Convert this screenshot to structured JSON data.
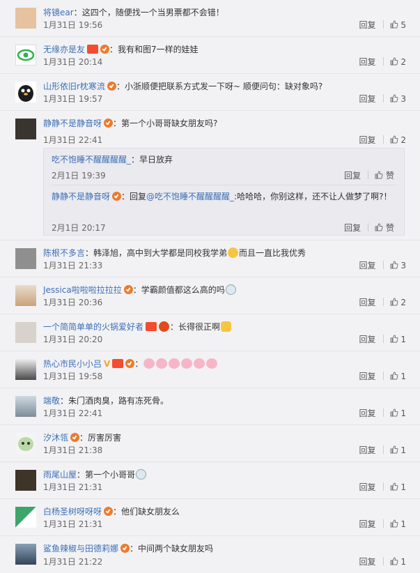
{
  "labels": {
    "reply": "回复",
    "like": "赞"
  },
  "comments": [
    {
      "user": "将镜ear",
      "text": "这四个，随便找一个当男票都不会错！",
      "time": "1月31日 19:56",
      "likes": "5",
      "avatar": "#e6c2a0"
    },
    {
      "user": "无缘亦是友",
      "text": "我有和图7一样的娃娃",
      "time": "1月31日 20:14",
      "likes": "2",
      "avatar": "#2db34a"
    },
    {
      "user": "山形依旧r枕寒流",
      "text": "小浙顺便把联系方式发一下呀~ 顺便问句：缺对象吗?",
      "time": "1月31日 19:57",
      "likes": "3",
      "avatar": "#222222"
    },
    {
      "user": "静静不是静音呀",
      "text": "第一个小哥哥缺女朋友吗?",
      "time": "1月31日 22:41",
      "likes": "2",
      "avatar": "#3a3430"
    },
    {
      "user": "陈根不多言",
      "text_a": "韩泽旭，高中到大学都是同校我学弟",
      "text_b": "而且一直比我优秀",
      "time": "1月31日 21:33",
      "likes": "3",
      "avatar": "#8f8f8f"
    },
    {
      "user": "Jessica啦啦啦拉拉拉",
      "text": "学霸颜值都这么高的吗",
      "time": "1月31日 20:36",
      "likes": "2",
      "avatar": "#c9a27c"
    },
    {
      "user": "一个简简单单的火锅爱好者",
      "text": "长得很正啊",
      "time": "1月31日 20:20",
      "likes": "1",
      "avatar": "#d8d2cc"
    },
    {
      "user": "热心市民小小吕",
      "time": "1月31日 19:58",
      "likes": "1",
      "avatar": "#4a4a4a"
    },
    {
      "user": "端敬",
      "text": "朱门酒肉臭，路有冻死骨。",
      "time": "1月31日 22:41",
      "likes": "1",
      "avatar": "#7d8c99"
    },
    {
      "user": "汐沐瓴",
      "text": "厉害厉害",
      "time": "1月31日 21:38",
      "likes": "1",
      "avatar": "#b9d9a8"
    },
    {
      "user": "雨尾山屋",
      "text": "第一个小哥哥",
      "time": "1月31日 21:31",
      "likes": "1",
      "avatar": "#3e3428"
    },
    {
      "user": "白杨圣树呀呀呀",
      "text": "他们缺女朋友么",
      "time": "1月31日 21:31",
      "likes": "1",
      "avatar": "#3aa66a"
    },
    {
      "user": "鲨鱼辣椒与田德莉娜",
      "text": "中间两个缺女朋友吗",
      "time": "1月31日 21:22",
      "likes": "1",
      "avatar": "#334455"
    }
  ],
  "sub_replies": [
    {
      "user": "吃不饱睡不醒醒醒醒_",
      "text": "早日放弃",
      "time": "2月1日 19:39"
    },
    {
      "user": "静静不是静音呀",
      "prefix": "回复",
      "mention": "@吃不饱睡不醒醒醒醒_",
      "text": ":哈哈哈，你别这样，还不让人做梦了啊?！",
      "time": "2月1日 20:17"
    }
  ]
}
